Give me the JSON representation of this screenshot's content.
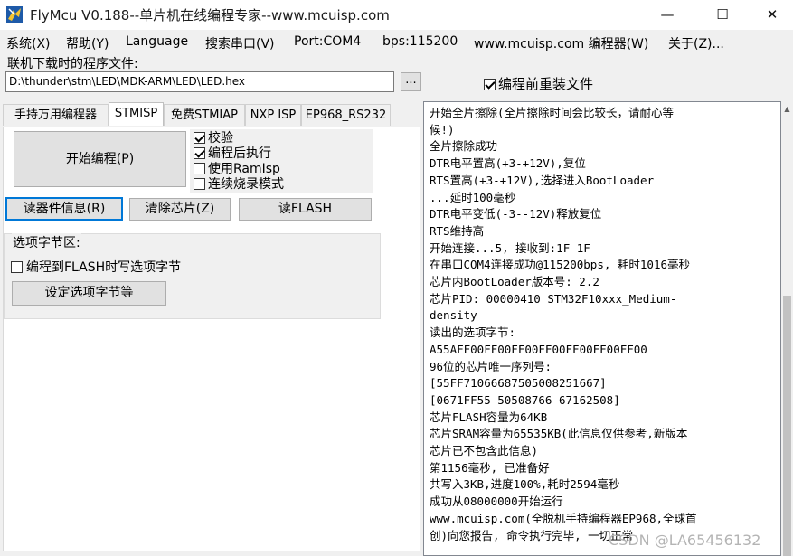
{
  "window": {
    "title": "FlyMcu V0.188--单片机在线编程专家--www.mcuisp.com",
    "minimize": "—",
    "maximize": "☐",
    "close": "✕"
  },
  "menu": {
    "items": [
      "系统(X)",
      "帮助(Y)",
      "Language",
      "搜索串口(V)",
      "Port:COM4",
      "bps:115200",
      "www.mcuisp.com 编程器(W)",
      "关于(Z)..."
    ]
  },
  "file": {
    "label": "联机下载时的程序文件:",
    "path": "D:\\thunder\\stm\\LED\\MDK-ARM\\LED\\LED.hex",
    "browse_label": "...",
    "reload_label": "编程前重装文件",
    "reload_checked": true
  },
  "tabs": [
    "手持万用编程器",
    "STMISP",
    "免费STMIAP",
    "NXP ISP",
    "EP968_RS232"
  ],
  "active_tab": "STMISP",
  "stmisp": {
    "start_button": "开始编程(P)",
    "options": [
      {
        "label": "校验",
        "checked": true
      },
      {
        "label": "编程后执行",
        "checked": true
      },
      {
        "label": "使用RamIsp",
        "checked": false
      },
      {
        "label": "连续烧录模式",
        "checked": false
      }
    ],
    "read_info_button": "读器件信息(R)",
    "erase_button": "清除芯片(Z)",
    "read_flash_button": "读FLASH",
    "option_bytes": {
      "title": "选项字节区:",
      "write_label": "编程到FLASH时写选项字节",
      "write_checked": false,
      "set_button": "设定选项字节等"
    }
  },
  "log": {
    "lines": [
      "开始全片擦除(全片擦除时间会比较长，请耐心等",
      "候!)",
      "全片擦除成功",
      "DTR电平置高(+3-+12V),复位",
      "RTS置高(+3-+12V),选择进入BootLoader",
      "...延时100毫秒",
      "DTR电平变低(-3--12V)释放复位",
      "RTS维持高",
      "开始连接...5, 接收到:1F 1F",
      "在串口COM4连接成功@115200bps, 耗时1016毫秒",
      "芯片内BootLoader版本号: 2.2",
      "芯片PID: 00000410  STM32F10xxx_Medium-",
      "density",
      "读出的选项字节:",
      "A55AFF00FF00FF00FF00FF00FF00FF00",
      "96位的芯片唯一序列号:",
      "[55FF71066687505008251667]",
      "[0671FF55 50508766 67162508]",
      "芯片FLASH容量为64KB",
      "芯片SRAM容量为65535KB(此信息仅供参考,新版本",
      "芯片已不包含此信息)",
      "第1156毫秒, 已准备好",
      "共写入3KB,进度100%,耗时2594毫秒",
      "成功从08000000开始运行",
      "www.mcuisp.com(全脱机手持编程器EP968,全球首",
      "创)向您报告, 命令执行完毕, 一切正常"
    ]
  },
  "watermark": "CSDN @LA65456132",
  "colors": {
    "accent_focus": "#0078d7",
    "button_face": "#e1e1e1",
    "window_bg": "#f0f0f0"
  }
}
